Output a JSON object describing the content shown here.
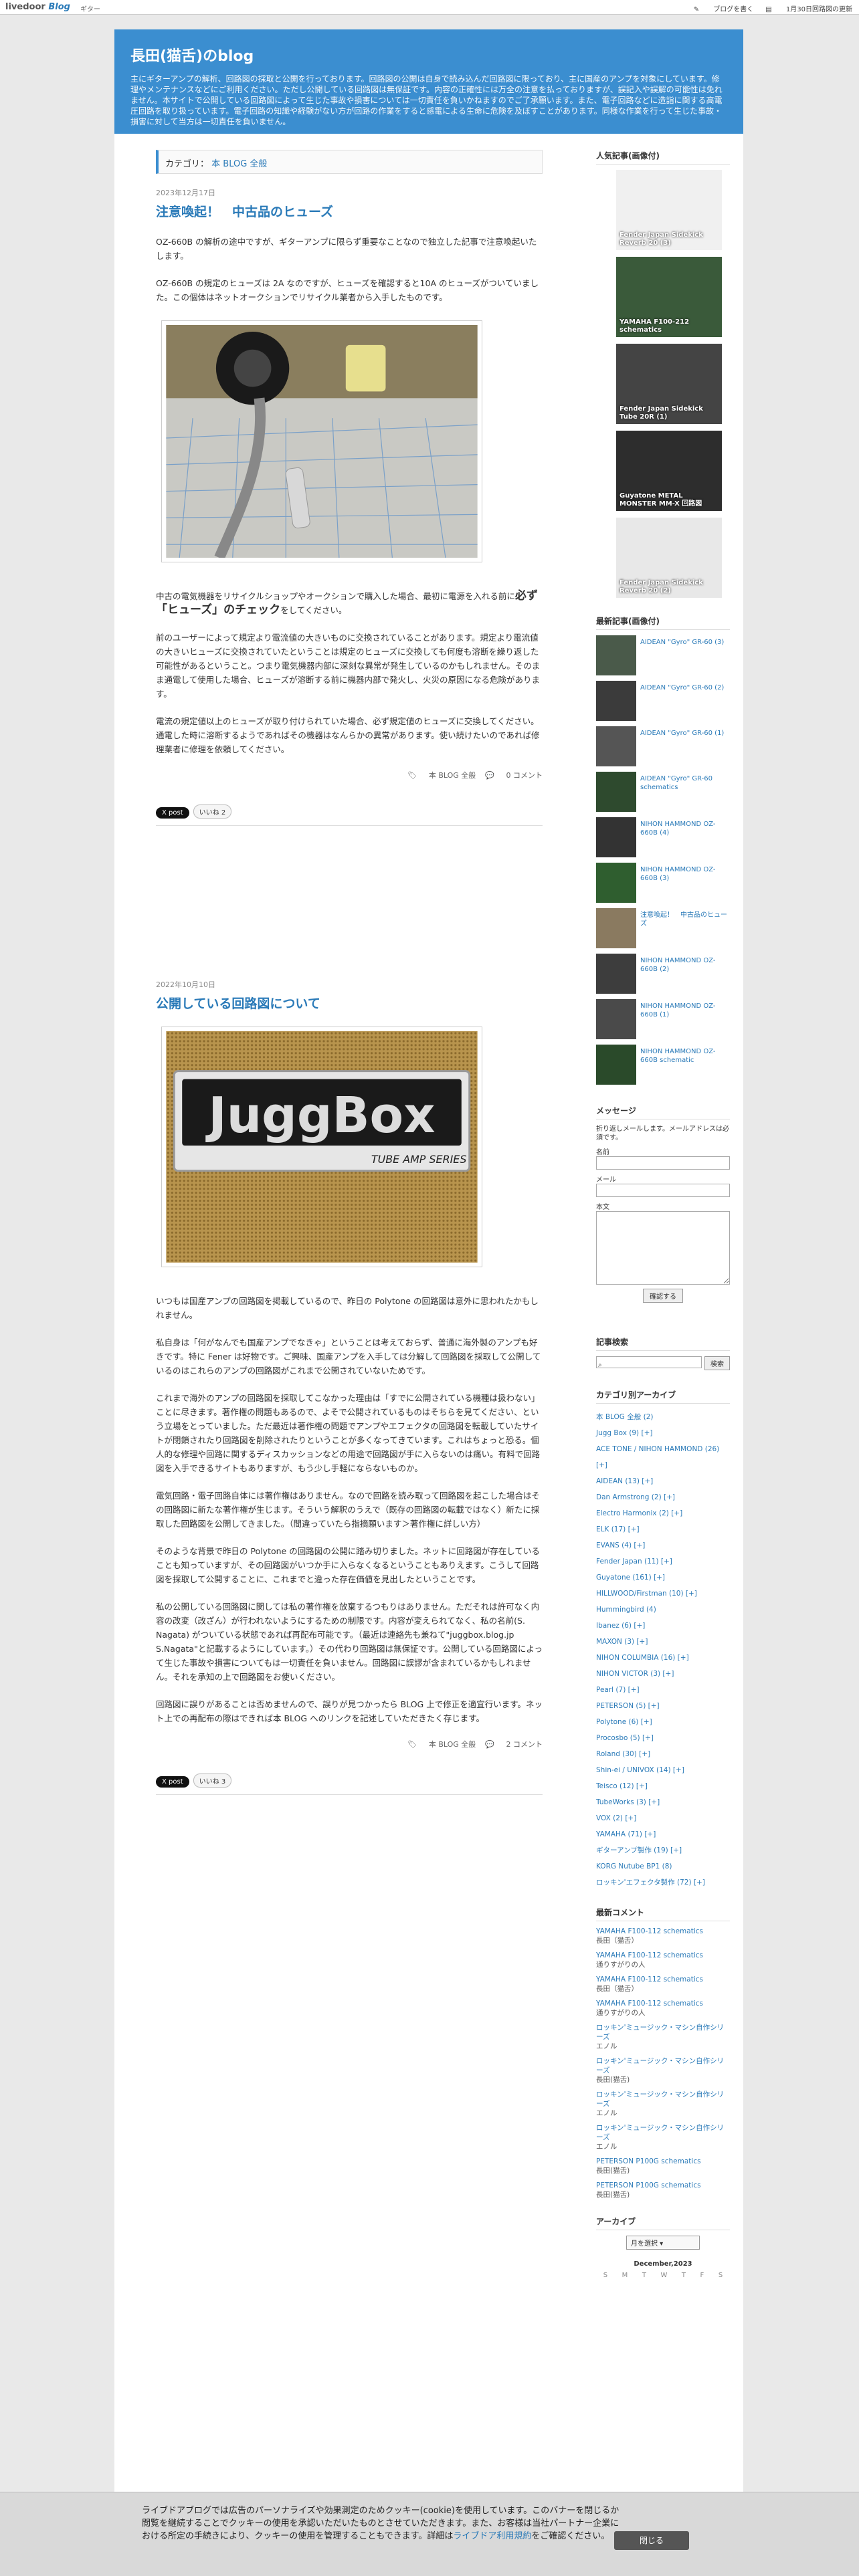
{
  "topbar": {
    "logo": "livedoor",
    "logo_blog": "Blog",
    "sub": "ギター",
    "write": "ブログを書く",
    "update": "1月30日回路図の更新"
  },
  "header": {
    "title": "長田(猫舌)のblog",
    "desc": "主にギターアンプの解析、回路図の採取と公開を行っております。回路図の公開は自身で読み込んだ回路図に限っており、主に国産のアンプを対象にしています。修理やメンテナンスなどにご利用ください。ただし公開している回路図は無保証です。内容の正確性には万全の注意を払っておりますが、誤記入や誤解の可能性は免れません。本サイトで公開している回路図によって生じた事故や損害については一切責任を負いかねますのでご了承願います。また、電子回路などに造詣に関する高電圧回路を取り扱っています。電子回路の知識や経験がない方が回路の作業をすると感電による生命に危険を及ぼすことがあります。同様な作業を行って生じた事故・損害に対して当方は一切責任を負いません。"
  },
  "category": {
    "label": "カテゴリ：",
    "value": "本 BLOG 全般"
  },
  "post1": {
    "date": "2023年12月17日",
    "title": "注意喚起！　中古品のヒューズ",
    "p1": "OZ-660B の解析の途中ですが、ギターアンプに限らず重要なことなので独立した記事で注意喚起いたします。",
    "p2": "OZ-660B の規定のヒューズは 2A なのですが、ヒューズを確認すると10A のヒューズがついていました。この個体はネットオークションでリサイクル業者から入手したものです。",
    "p3a": "中古の電気機器をリサイクルショップやオークションで購入した場合、最初に電源を入れる前に",
    "p3em": "必ず「ヒューズ」のチェック",
    "p3b": "をしてください。",
    "p4": "前のユーザーによって規定より電流値の大きいものに交換されていることがあります。規定より電流値の大きいヒューズに交換されていたということは規定のヒューズに交換しても何度も溶断を繰り返した可能性があるということ。つまり電気機器内部に深刻な異常が発生しているのかもしれません。そのまま通電して使用した場合、ヒューズが溶断する前に機器内部で発火し、火災の原因になる危険があります。",
    "p5": "電流の規定値以上のヒューズが取り付けられていた場合、必ず規定値のヒューズに交換してください。通電した時に溶断するようであればその機器はなんらかの異常があります。使い続けたいのであれば修理業者に修理を依頼してください。",
    "meta_cat": "本 BLOG 全般",
    "meta_cmt": "0 コメント",
    "share_x": "X post",
    "share_like": "いいね 2"
  },
  "post2": {
    "date": "2022年10月10日",
    "title": "公開している回路図について",
    "badge1": "JuggBox",
    "badge2": "TUBE AMP SERIES",
    "p1": "いつもは国産アンプの回路図を掲載しているので、昨日の Polytone の回路図は意外に思われたかもしれません。",
    "p2": "私自身は「何がなんでも国産アンプでなきゃ」ということは考えておらず、普通に海外製のアンプも好きです。特に Fener は好物です。ご興味、国産アンプを入手しては分解して回路図を採取して公開しているのはこれらのアンプの回路図がこれまで公開されていないためです。",
    "p3": "これまで海外のアンプの回路図を採取してこなかった理由は「すでに公開されている機種は扱わない」ことに尽きます。著作権の問題もあるので、よそで公開されているものはそちらを見てください、という立場をとっていました。ただ最近は著作権の問題でアンプやエフェクタの回路図を転載していたサイトが閉鎖されたり回路図を削除されたりということが多くなってきています。これはちょっと恐る。個人的な修理や回路に関するディスカッションなどの用途で回路図が手に入らないのは痛い。有料で回路図を入手できるサイトもありますが、もう少し手軽にならないものか。",
    "p4": "電気回路・電子回路自体には著作権はありません。なので回路を読み取って回路図を起こした場合はその回路図に新たな著作権が生じます。そういう解釈のうえで（既存の回路図の転載ではなく）新たに採取した回路図を公開してきました。（間違っていたら指摘願います＞著作権に詳しい方）",
    "p5": "そのような背景で昨日の Polytone の回路図の公開に踏み切りました。ネットに回路図が存在していることも知っていますが、その回路図がいつか手に入らなくなるということもありえます。こうして回路図を採取して公開することに、これまでと違った存在価値を見出したということです。",
    "p6": "私の公開している回路図に関しては私の著作権を放棄するつもりはありません。ただそれは許可なく内容の改変（改ざん）が行われないようにするための制限です。内容が変えられてなく、私の名前(S. Nagata) がついている状態であれば再配布可能です。（最近は連絡先も兼ねて\"juggbox.blog.jp S.Nagata\"と記載するようにしています。）その代わり回路図は無保証です。公開している回路図によって生じた事故や損害についてもは一切責任を負いません。回路図に誤謬が含まれているかもしれません。それを承知の上で回路図をお使いください。",
    "p7": "回路図に誤りがあることは否めませんので、誤りが見つかったら BLOG 上で修正を適宜行います。ネット上での再配布の際はできれば本 BLOG へのリンクを記述していただきたく存じます。",
    "meta_cat": "本 BLOG 全般",
    "meta_cmt": "2 コメント",
    "share_x": "X post",
    "share_like": "いいね 3"
  },
  "side": {
    "popular_title": "人気記事(画像付)",
    "popular": [
      "Fender Japan Sidekick Reverb 20 (3)",
      "YAMAHA F100-212 schematics",
      "Fender Japan Sidekick Tube 20R (1)",
      "Guyatone METAL MONSTER MM-X 回路図",
      "Fender Japan Sidekick Reverb 20 (2)"
    ],
    "recent_title": "最新記事(画像付)",
    "recent": [
      "AIDEAN \"Gyro\" GR-60 (3)",
      "AIDEAN \"Gyro\" GR-60 (2)",
      "AIDEAN \"Gyro\" GR-60 (1)",
      "AIDEAN \"Gyro\" GR-60 schematics",
      "NIHON HAMMOND OZ-660B (4)",
      "NIHON HAMMOND OZ-660B (3)",
      "注意喚起！　中古品のヒューズ",
      "NIHON HAMMOND OZ-660B (2)",
      "NIHON HAMMOND OZ-660B (1)",
      "NIHON HAMMOND OZ-660B schematic"
    ],
    "msg_title": "メッセージ",
    "msg_desc": "折り返しメールします。メールアドレスは必須です。",
    "msg_name": "名前",
    "msg_mail": "メール",
    "msg_body": "本文",
    "msg_btn": "確認する",
    "search_title": "記事検索",
    "search_btn": "検索",
    "cat_title": "カテゴリ別アーカイブ",
    "cats": [
      "本 BLOG 全般 (2)",
      "Jugg Box (9) [+]",
      "ACE TONE / NIHON HAMMOND (26) [+]",
      "AIDEAN (13) [+]",
      "Dan Armstrong (2) [+]",
      "Electro Harmonix (2) [+]",
      "ELK (17) [+]",
      "EVANS (4) [+]",
      "Fender Japan (11) [+]",
      "Guyatone (161) [+]",
      "HILLWOOD/Firstman (10) [+]",
      "Hummingbird (4)",
      "Ibanez (6) [+]",
      "MAXON (3) [+]",
      "NIHON COLUMBIA (16) [+]",
      "NIHON VICTOR (3) [+]",
      "Pearl (7) [+]",
      "PETERSON (5) [+]",
      "Polytone (6) [+]",
      "Procosbo (5) [+]",
      "Roland (30) [+]",
      "Shin-ei / UNIVOX (14) [+]",
      "Teisco (12) [+]",
      "TubeWorks (3) [+]",
      "VOX (2) [+]",
      "YAMAHA (71) [+]",
      "ギターアンプ製作 (19) [+]",
      "KORG Nutube BP1 (8)",
      "ロッキン'エフェクタ製作 (72) [+]"
    ],
    "cmt_title": "最新コメント",
    "cmts": [
      [
        "YAMAHA F100-112 schematics",
        "長田（猫舌）"
      ],
      [
        "YAMAHA F100-112 schematics",
        "通りすがりの人"
      ],
      [
        "YAMAHA F100-112 schematics",
        "長田（猫舌）"
      ],
      [
        "YAMAHA F100-112 schematics",
        "通りすがりの人"
      ],
      [
        "ロッキン'ミュージック・マシン自作シリーズ",
        "エノル"
      ],
      [
        "ロッキン'ミュージック・マシン自作シリーズ",
        "長田(猫舌)"
      ],
      [
        "ロッキン'ミュージック・マシン自作シリーズ",
        "エノル"
      ],
      [
        "ロッキン'ミュージック・マシン自作シリーズ",
        "エノル"
      ],
      [
        "PETERSON P100G schematics",
        "長田(猫舌)"
      ],
      [
        "PETERSON P100G schematics",
        "長田(猫舌)"
      ]
    ],
    "arch_title": "アーカイブ",
    "arch_sel": "月を選択",
    "cal_title": "December,2023",
    "cal_days": [
      "S",
      "M",
      "T",
      "W",
      "T",
      "F",
      "S"
    ]
  },
  "cookie": {
    "text": "ライブドアブログでは広告のパーソナライズや効果測定のためクッキー(cookie)を使用しています。このバナーを閉じるか閲覧を継続することでクッキーの使用を承認いただいたものとさせていただきます。また、お客様は当社パートナー企業における所定の手続きにより、クッキーの使用を管理することもできます。詳細は",
    "link": "ライブドア利用規約",
    "tail": "をご確認ください。",
    "close": "閉じる"
  }
}
